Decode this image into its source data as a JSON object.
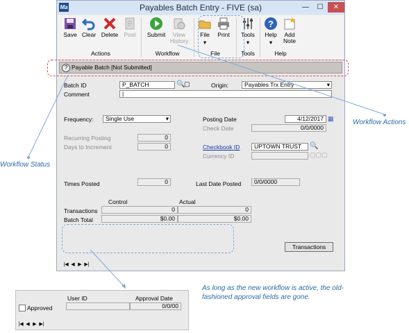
{
  "window": {
    "title": "Payables Batch Entry  -  FIVE (sa)",
    "app_icon_text": "Ma",
    "controls": [
      "minimize-icon",
      "maximize-icon",
      "close-icon"
    ]
  },
  "ribbon": {
    "buttons": {
      "save": "Save",
      "clear": "Clear",
      "delete": "Delete",
      "post": "Post",
      "submit": "Submit",
      "view_history": "View History",
      "file": "File",
      "print": "Print",
      "tools": "Tools",
      "help": "Help",
      "add_note": "Add Note"
    },
    "groups": {
      "actions": "Actions",
      "workflow": "Workflow",
      "file": "File",
      "tools": "Tools",
      "help": "Help"
    }
  },
  "status": {
    "text": "Payable Batch [Not Submitted]"
  },
  "form": {
    "batch_id_label": "Batch ID",
    "batch_id": "P_BATCH",
    "origin_label": "Origin:",
    "origin": "Payables Trx Entry",
    "comment_label": "Comment",
    "comment": "|",
    "frequency_label": "Frequency:",
    "frequency": "Single Use",
    "recurring_posting_label": "Recurring Posting",
    "recurring_posting": "0",
    "days_to_increment_label": "Days to Increment",
    "days_to_increment": "0",
    "posting_date_label": "Posting Date",
    "posting_date": "4/12/2017",
    "check_date_label": "Check Date",
    "check_date": "0/0/0000",
    "checkbook_id_label": "Checkbook ID",
    "checkbook_id": "UPTOWN TRUST",
    "currency_id_label": "Currency ID",
    "currency_id": "",
    "times_posted_label": "Times Posted",
    "times_posted": "0",
    "last_date_posted_label": "Last Date Posted",
    "last_date_posted": "0/0/0000",
    "control_header": "Control",
    "actual_header": "Actual",
    "transactions_label": "Transactions",
    "transactions_control": "0",
    "transactions_actual": "0",
    "batch_total_label": "Batch Total",
    "batch_total_control": "$0.00",
    "batch_total_actual": "$0.00",
    "transactions_button": "Transactions"
  },
  "callouts": {
    "workflow_actions": "Workflow Actions",
    "workflow_status": "Workflow Status",
    "note": "As long as the new workflow is active, the old-fashioned approval fields are gone."
  },
  "legacy": {
    "user_id_label": "User ID",
    "approval_date_label": "Approval Date",
    "approval_date": "0/0/00",
    "approved_label": "Approved"
  },
  "colors": {
    "accent": "#2e6aa6",
    "callout_line": "#7fa7d8",
    "status_border": "#e05050",
    "close_button": "#c75050"
  }
}
